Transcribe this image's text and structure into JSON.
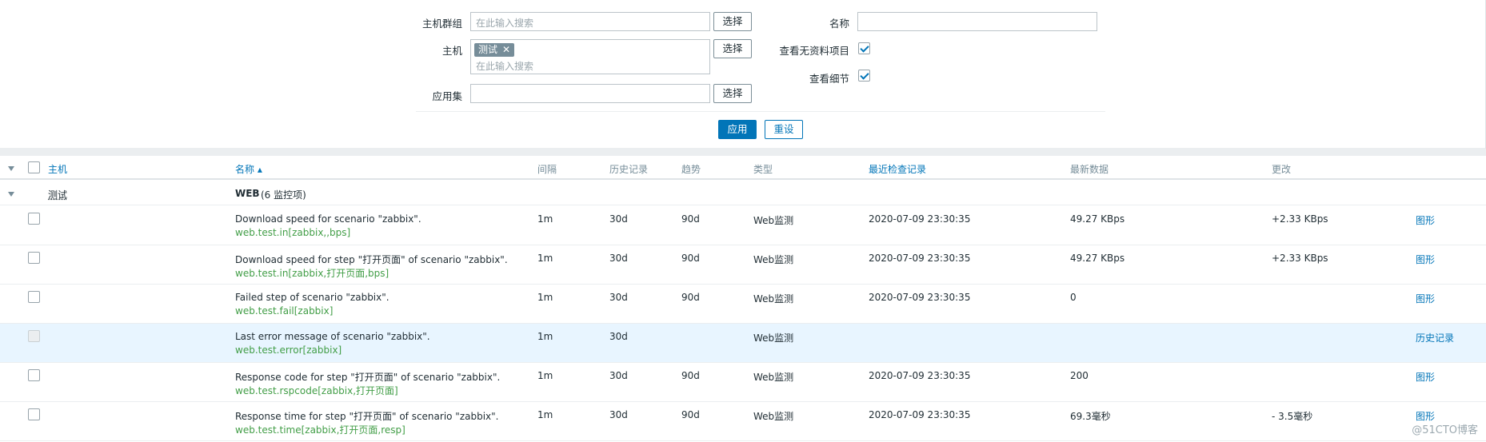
{
  "filter": {
    "host_groups_label": "主机群组",
    "host_groups_placeholder": "在此输入搜索",
    "hosts_label": "主机",
    "hosts_tag": "测试",
    "hosts_placeholder": "在此输入搜索",
    "application_label": "应用集",
    "select_label": "选择",
    "name_label": "名称",
    "show_no_data_label": "查看无资料项目",
    "show_details_label": "查看细节",
    "apply_label": "应用",
    "reset_label": "重设"
  },
  "table": {
    "headers": {
      "host": "主机",
      "name": "名称 ▴",
      "interval": "间隔",
      "history": "历史记录",
      "trends": "趋势",
      "type": "类型",
      "last_check": "最近检查记录",
      "last_value": "最新数据",
      "change": "更改"
    },
    "group": {
      "host": "测试",
      "app": "WEB",
      "count": "(6 监控项)"
    },
    "rows": [
      {
        "name": "Download speed for scenario \"zabbix\".",
        "key": "web.test.in[zabbix,,bps]",
        "interval": "1m",
        "history": "30d",
        "trends": "90d",
        "type": "Web监测",
        "last_check": "2020-07-09 23:30:35",
        "last_value": "49.27 KBps",
        "change": "+2.33 KBps",
        "action": "图形"
      },
      {
        "name": "Download speed for step \"打开页面\" of scenario \"zabbix\".",
        "key": "web.test.in[zabbix,打开页面,bps]",
        "interval": "1m",
        "history": "30d",
        "trends": "90d",
        "type": "Web监测",
        "last_check": "2020-07-09 23:30:35",
        "last_value": "49.27 KBps",
        "change": "+2.33 KBps",
        "action": "图形"
      },
      {
        "name": "Failed step of scenario \"zabbix\".",
        "key": "web.test.fail[zabbix]",
        "interval": "1m",
        "history": "30d",
        "trends": "90d",
        "type": "Web监测",
        "last_check": "2020-07-09 23:30:35",
        "last_value": "0",
        "change": "",
        "action": "图形"
      },
      {
        "name": "Last error message of scenario \"zabbix\".",
        "key": "web.test.error[zabbix]",
        "interval": "1m",
        "history": "30d",
        "trends": "",
        "type": "Web监测",
        "last_check": "",
        "last_value": "",
        "change": "",
        "action": "历史记录"
      },
      {
        "name": "Response code for step \"打开页面\" of scenario \"zabbix\".",
        "key": "web.test.rspcode[zabbix,打开页面]",
        "interval": "1m",
        "history": "30d",
        "trends": "90d",
        "type": "Web监测",
        "last_check": "2020-07-09 23:30:35",
        "last_value": "200",
        "change": "",
        "action": "图形"
      },
      {
        "name": "Response time for step \"打开页面\" of scenario \"zabbix\".",
        "key": "web.test.time[zabbix,打开页面,resp]",
        "interval": "1m",
        "history": "30d",
        "trends": "90d",
        "type": "Web监测",
        "last_check": "2020-07-09 23:30:35",
        "last_value": "69.3毫秒",
        "change": "- 3.5毫秒",
        "action": "图形"
      }
    ]
  },
  "watermark": "@51CTO博客"
}
